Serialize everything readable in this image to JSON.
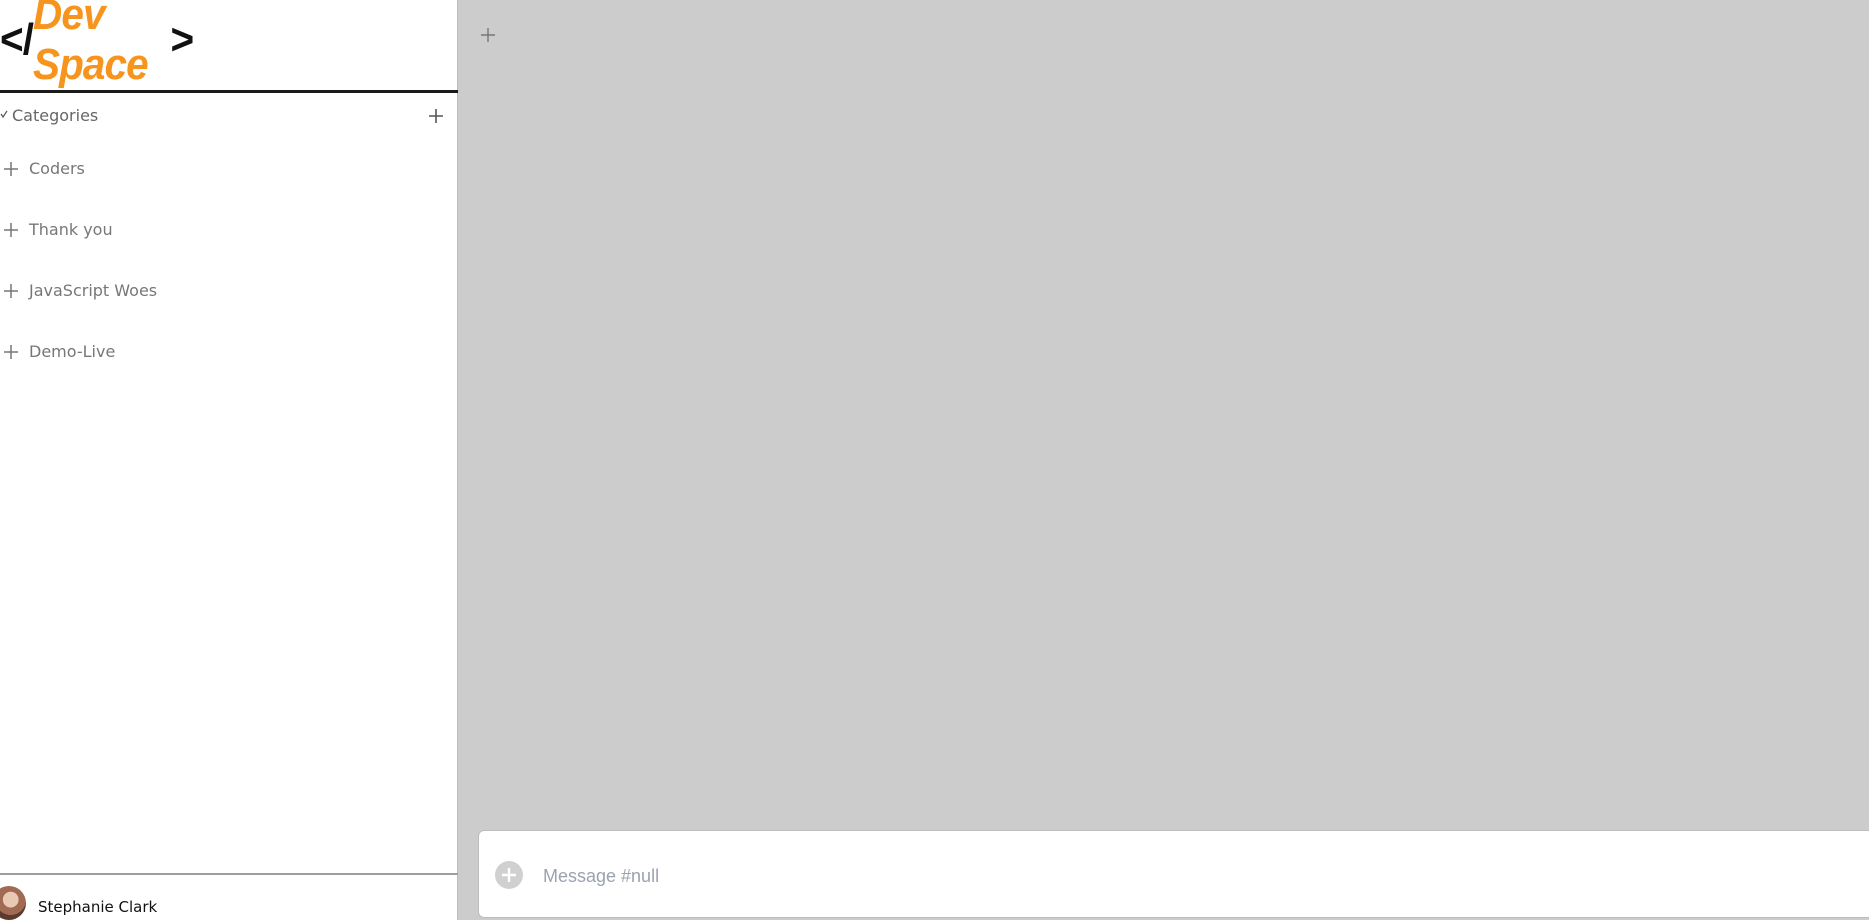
{
  "logo": {
    "open_bracket": "</",
    "name": "Dev Space",
    "close_bracket": ">"
  },
  "sidebar": {
    "categories_title": "Categories",
    "channels": [
      {
        "label": "Coders"
      },
      {
        "label": "Thank you"
      },
      {
        "label": "JavaScript Woes"
      },
      {
        "label": "Demo-Live"
      }
    ]
  },
  "user": {
    "name": "Stephanie Clark"
  },
  "composer": {
    "placeholder": "Message #null"
  },
  "colors": {
    "brand_orange": "#f7941d",
    "main_background": "#cccccc"
  },
  "icons": {
    "category_toggle": "chevron-down-icon",
    "add": "plus-icon",
    "attach": "plus-circle-icon"
  }
}
